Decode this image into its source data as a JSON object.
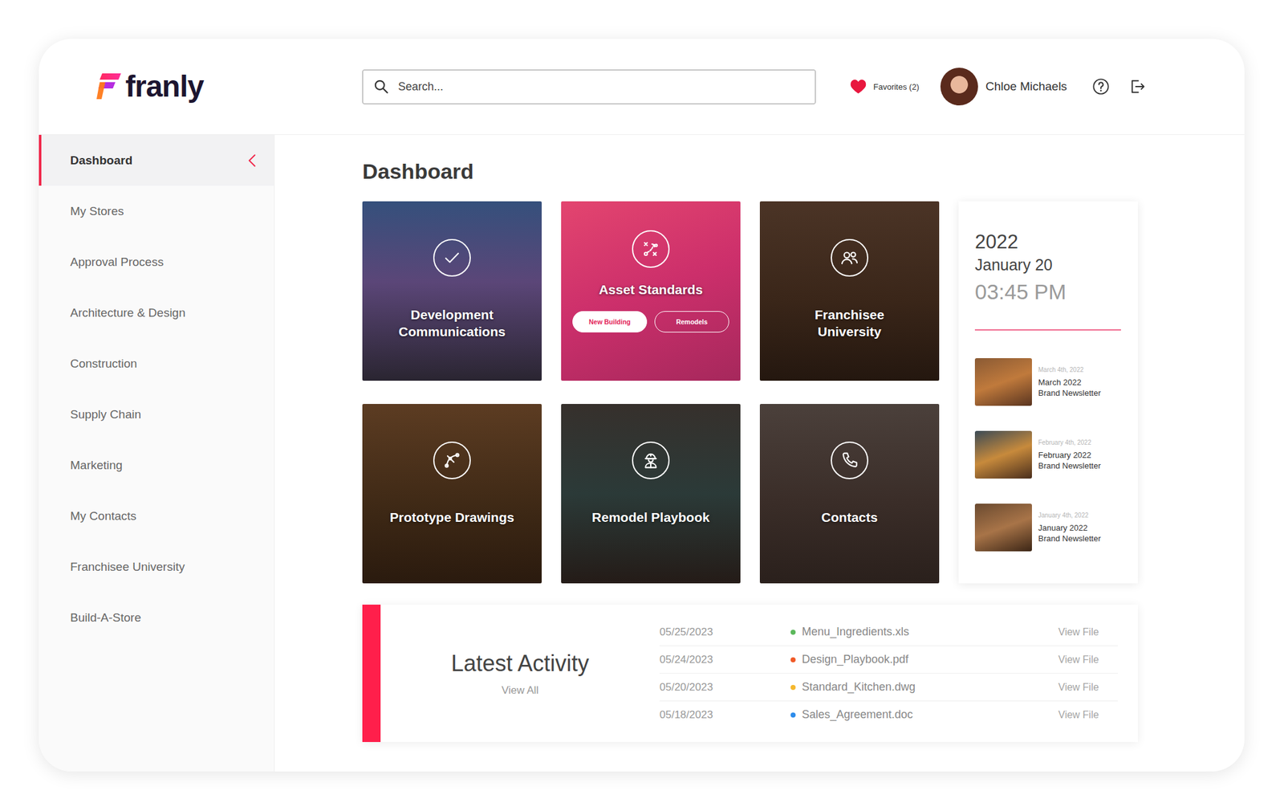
{
  "logo": {
    "text": "franly"
  },
  "search": {
    "placeholder": "Search..."
  },
  "header": {
    "favorites": "Favorites (2)",
    "user": {
      "name": "Chloe Michaels"
    }
  },
  "sidebar": {
    "items": [
      {
        "label": "Dashboard",
        "selected": true
      },
      {
        "label": "My Stores",
        "selected": false
      },
      {
        "label": "Approval Process",
        "selected": false
      },
      {
        "label": "Architecture & Design",
        "selected": false
      },
      {
        "label": "Construction",
        "selected": false
      },
      {
        "label": "Supply Chain",
        "selected": false
      },
      {
        "label": "Marketing",
        "selected": false
      },
      {
        "label": "My Contacts",
        "selected": false
      },
      {
        "label": "Franchisee University",
        "selected": false
      },
      {
        "label": "Build-A-Store",
        "selected": false
      }
    ]
  },
  "page_title": "Dashboard",
  "tiles": [
    {
      "lines": [
        "Development",
        "Communications"
      ],
      "buttons": []
    },
    {
      "lines": [
        "Asset Standards"
      ],
      "buttons": [
        {
          "label": "New Building",
          "kind": "filled"
        },
        {
          "label": "Remodels",
          "kind": "outline"
        }
      ]
    },
    {
      "lines": [
        "Franchisee",
        "University"
      ],
      "buttons": []
    },
    {
      "lines": [
        "Prototype Drawings"
      ],
      "buttons": []
    },
    {
      "lines": [
        "Remodel Playbook"
      ],
      "buttons": []
    },
    {
      "lines": [
        "Contacts"
      ],
      "buttons": []
    }
  ],
  "date_panel": {
    "year": "2022",
    "date": "January 20",
    "time": "03:45 PM",
    "newsletters": [
      {
        "date": "March 4th, 2022",
        "lines": [
          "March 2022",
          "Brand Newsletter"
        ]
      },
      {
        "date": "February 4th, 2022",
        "lines": [
          "February 2022",
          "Brand Newsletter"
        ]
      },
      {
        "date": "January 4th, 2022",
        "lines": [
          "January 2022",
          "Brand Newsletter"
        ]
      }
    ]
  },
  "activity": {
    "title": "Latest Activity",
    "view_all": "View All",
    "rows": [
      {
        "date": "05/25/2023",
        "file": "Menu_Ingredients.xls",
        "color": "#5cb85c",
        "action": "View File"
      },
      {
        "date": "05/24/2023",
        "file": "Design_Playbook.pdf",
        "color": "#f05a28",
        "action": "View File"
      },
      {
        "date": "05/20/2023",
        "file": "Standard_Kitchen.dwg",
        "color": "#f5b82e",
        "action": "View File"
      },
      {
        "date": "05/18/2023",
        "file": "Sales_Agreement.doc",
        "color": "#2d8ceb",
        "action": "View File"
      }
    ]
  }
}
